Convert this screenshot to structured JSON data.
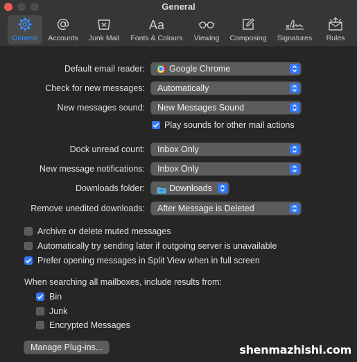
{
  "window": {
    "title": "General",
    "traffic_lights": [
      "#ee5b52",
      "#4d4d4d",
      "#4d4d4d"
    ]
  },
  "tabs": [
    {
      "label": "General",
      "icon": "gear-icon",
      "selected": true
    },
    {
      "label": "Accounts",
      "icon": "at-sign-icon"
    },
    {
      "label": "Junk Mail",
      "icon": "junk-tray-icon"
    },
    {
      "label": "Fonts & Colours",
      "icon": "fonts-icon",
      "glyph": "Aa"
    },
    {
      "label": "Viewing",
      "icon": "glasses-icon"
    },
    {
      "label": "Composing",
      "icon": "compose-icon"
    },
    {
      "label": "Signatures",
      "icon": "signature-icon"
    },
    {
      "label": "Rules",
      "icon": "rules-envelope-icon"
    }
  ],
  "settings": {
    "default_email_reader": {
      "label": "Default email reader:",
      "value": "Google Chrome",
      "icon": "chrome-icon"
    },
    "check_messages": {
      "label": "Check for new messages:",
      "value": "Automatically"
    },
    "messages_sound": {
      "label": "New messages sound:",
      "value": "New Messages Sound"
    },
    "play_sounds": {
      "label": "Play sounds for other mail actions",
      "checked": true
    },
    "dock_unread": {
      "label": "Dock unread count:",
      "value": "Inbox Only"
    },
    "notifications": {
      "label": "New message notifications:",
      "value": "Inbox Only"
    },
    "downloads_folder": {
      "label": "Downloads folder:",
      "value": "Downloads",
      "icon": "folder-icon"
    },
    "remove_downloads": {
      "label": "Remove unedited downloads:",
      "value": "After Message is Deleted"
    }
  },
  "options": [
    {
      "label": "Archive or delete muted messages",
      "checked": false
    },
    {
      "label": "Automatically try sending later if outgoing server is unavailable",
      "checked": false
    },
    {
      "label": "Prefer opening messages in Split View when in full screen",
      "checked": true
    }
  ],
  "search": {
    "heading": "When searching all mailboxes, include results from:",
    "items": [
      {
        "label": "Bin",
        "checked": true
      },
      {
        "label": "Junk",
        "checked": false
      },
      {
        "label": "Encrypted Messages",
        "checked": false
      }
    ]
  },
  "manage_plugins": "Manage Plug-ins...",
  "watermark": "shenmazhishi.com",
  "colors": {
    "accent": "#3478f6",
    "background": "#262626",
    "toolbar": "#363636"
  }
}
